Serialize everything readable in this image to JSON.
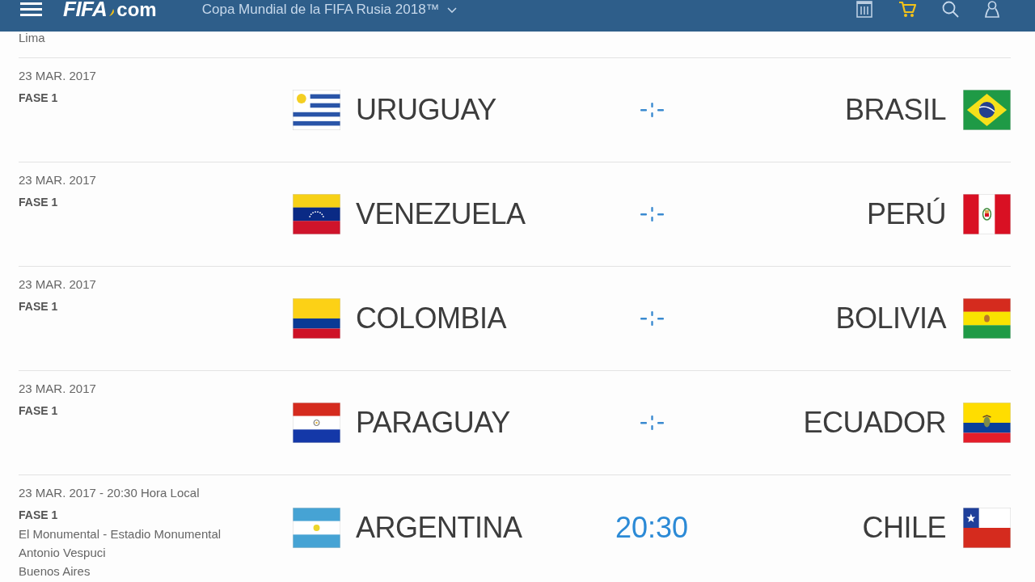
{
  "header": {
    "logo": {
      "name": "FIFA",
      "suffix": "com"
    },
    "competition": "Copa Mundial de la FIFA Rusia 2018™"
  },
  "previous_match": {
    "venue_lines": [
      "Lima"
    ]
  },
  "matches": [
    {
      "date": "23 MAR. 2017",
      "phase": "FASE 1",
      "home": {
        "name": "URUGUAY",
        "kind": "uruguay"
      },
      "center": {
        "kind": "pending"
      },
      "away": {
        "name": "BRASIL",
        "kind": "brazil"
      }
    },
    {
      "date": "23 MAR. 2017",
      "phase": "FASE 1",
      "home": {
        "name": "VENEZUELA",
        "kind": "venezuela"
      },
      "center": {
        "kind": "pending"
      },
      "away": {
        "name": "PERÚ",
        "kind": "peru"
      }
    },
    {
      "date": "23 MAR. 2017",
      "phase": "FASE 1",
      "home": {
        "name": "COLOMBIA",
        "kind": "colombia"
      },
      "center": {
        "kind": "pending"
      },
      "away": {
        "name": "BOLIVIA",
        "kind": "bolivia"
      }
    },
    {
      "date": "23 MAR. 2017",
      "phase": "FASE 1",
      "home": {
        "name": "PARAGUAY",
        "kind": "paraguay"
      },
      "center": {
        "kind": "pending"
      },
      "away": {
        "name": "ECUADOR",
        "kind": "ecuador"
      }
    },
    {
      "date": "23 MAR. 2017 - 20:30 Hora Local",
      "phase": "FASE 1",
      "venue_lines": [
        "El Monumental - Estadio Monumental",
        "Antonio Vespuci",
        "Buenos Aires"
      ],
      "home": {
        "name": "ARGENTINA",
        "kind": "argentina"
      },
      "center": {
        "kind": "time",
        "text": "20:30"
      },
      "away": {
        "name": "CHILE",
        "kind": "chile"
      }
    }
  ]
}
